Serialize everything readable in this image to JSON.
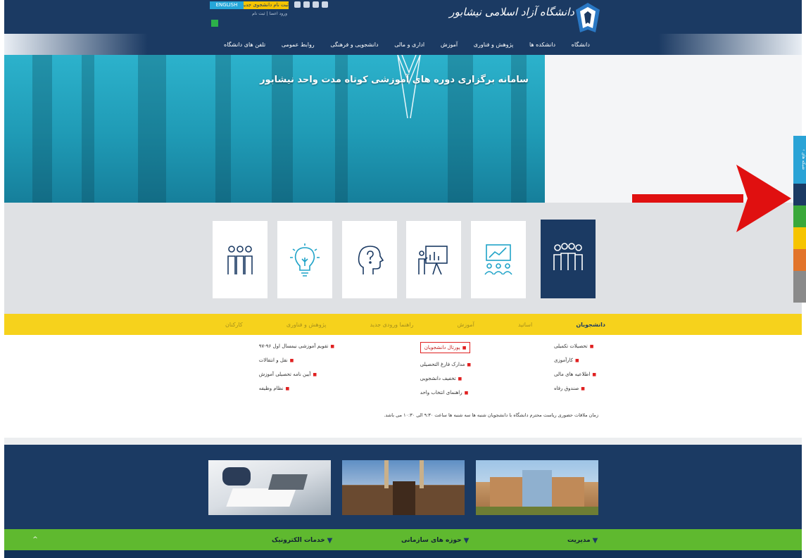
{
  "header": {
    "logo_text": "دانشگاه آزاد اسلامی نیشابور",
    "lang_label": "ENGLISH",
    "register_label": "ثبت نام دانشجوی جدید",
    "login_link": "ورود اعضا | ثبت نام",
    "icons": [
      "mail-icon",
      "home-icon",
      "user-icon",
      "sitemap-icon"
    ]
  },
  "nav": {
    "items": [
      "دانشگاه",
      "دانشکده ها",
      "پژوهش و فناوری",
      "آموزش",
      "اداری و مالی",
      "دانشجویی و فرهنگی",
      "روابط عمومی",
      "تلفن های دانشگاه"
    ]
  },
  "hero": {
    "title": "سامانه برگزاری دوره های آموزشی کوتاه مدت واحد نیشابور"
  },
  "tiles": {
    "icons": [
      "group-icon",
      "chart-group-icon",
      "presentation-icon",
      "head-question-icon",
      "lightbulb-icon",
      "team-icon"
    ]
  },
  "tabs": {
    "items": [
      "دانشجویان",
      "اساتید",
      "آموزش",
      "راهنما ورودی جدید",
      "پژوهش و فناوری",
      "کارکنان"
    ],
    "active": "دانشجویان"
  },
  "links": {
    "col_right": [
      "تحصیلات تکمیلی",
      "کارآموزی",
      "اطلاعیه های مالی",
      "صندوق رفاه"
    ],
    "col_middle": [
      "پورتال دانشجویان",
      "مدارک فارغ التحصیلی",
      "تخفیف دانشجویی",
      "راهنمای انتخاب واحد"
    ],
    "col_left": [
      "تقویم آموزشی نیمسال اول ۹۶-۹۷",
      "نقل و انتقالات",
      "آیین نامه تحصیلی آموزش",
      "نظام وظیفه"
    ],
    "hours_note": "زمان ملاقات حضوری ریاست محترم دانشگاه با دانشجویان شنبه ها سه شنبه ها ساعت ۹:۳۰ الی ۱۰:۳۰ می باشد."
  },
  "photos": [
    "university-building-photo",
    "mosque-photo",
    "office-desk-photo"
  ],
  "footer": {
    "items": [
      "مدیریت",
      "حوزه های سازمانی",
      "خدمات الکترونیک"
    ],
    "scroll_top": "^"
  },
  "sidebar": {
    "toggle_label": "‹ شبکه های",
    "buttons": [
      {
        "name": "telegram-icon",
        "color": "#1b3a63"
      },
      {
        "name": "person-icon",
        "color": "#3aa83a"
      },
      {
        "name": "at-icon",
        "color": "#f6c400"
      },
      {
        "name": "share-icon",
        "color": "#e2742a"
      },
      {
        "name": "rss-icon",
        "color": "#8a8a8a"
      }
    ]
  },
  "colors": {
    "primary": "#1b3a63",
    "accent_yellow": "#f6d21c",
    "accent_green": "#5fb92f",
    "highlight_red": "#e02020"
  }
}
